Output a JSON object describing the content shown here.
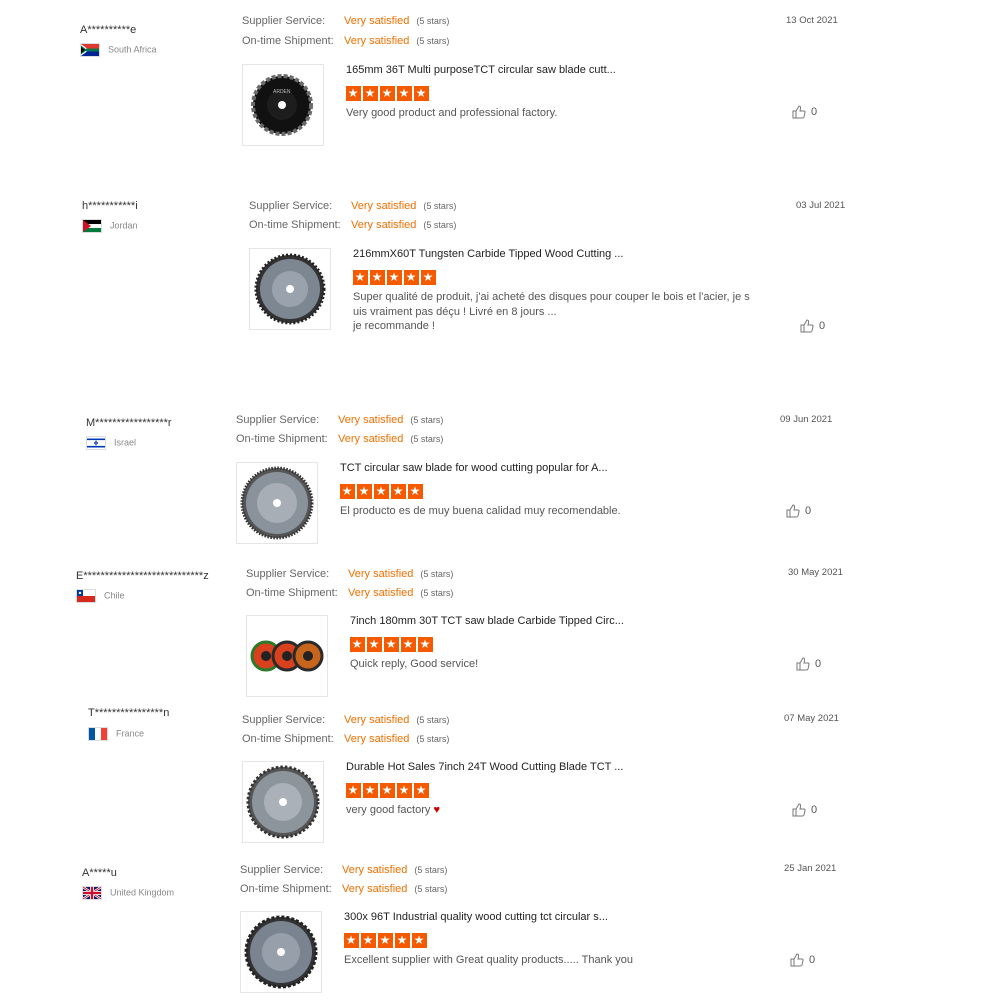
{
  "labels": {
    "supplier_service": "Supplier Service:",
    "ontime_shipment": "On-time Shipment:"
  },
  "reviews": [
    {
      "buyer": "A**********e",
      "country": "South Africa",
      "flag_icon": "south-africa-flag-icon",
      "supplier_service": "Very satisfied",
      "supplier_stars": "(5 stars)",
      "shipment": "Very satisfied",
      "shipment_stars": "(5 stars)",
      "date": "13 Oct 2021",
      "product_title": "165mm 36T Multi purposeTCT circular saw blade cutt...",
      "rating": 5,
      "comment": "Very good product and professional factory.",
      "likes": "0",
      "image_icon": "diamond-saw-blade-image"
    },
    {
      "buyer": "h***********i",
      "country": "Jordan",
      "flag_icon": "jordan-flag-icon",
      "supplier_service": "Very satisfied",
      "supplier_stars": "(5 stars)",
      "shipment": "Very satisfied",
      "shipment_stars": "(5 stars)",
      "date": "03 Jul 2021",
      "product_title": "216mmX60T Tungsten Carbide Tipped Wood Cutting ...",
      "rating": 5,
      "comment_lines": [
        "Super qualité de produit, j'ai acheté des disques pour couper le bois et l'acier, je s",
        "uis vraiment pas déçu ! Livré en 8 jours ...",
        "je recommande !"
      ],
      "likes": "0",
      "image_icon": "saw-blade-image"
    },
    {
      "buyer": "M*****************r",
      "country": "Israel",
      "flag_icon": "israel-flag-icon",
      "supplier_service": "Very satisfied",
      "supplier_stars": "(5 stars)",
      "shipment": "Very satisfied",
      "shipment_stars": "(5 stars)",
      "date": "09 Jun 2021",
      "product_title": "TCT circular saw blade for wood cutting popular for A...",
      "rating": 5,
      "comment": "El producto es de muy buena calidad muy recomendable.",
      "likes": "0",
      "image_icon": "saw-blade-image"
    },
    {
      "buyer": "E****************************z",
      "country": "Chile",
      "flag_icon": "chile-flag-icon",
      "supplier_service": "Very satisfied",
      "supplier_stars": "(5 stars)",
      "shipment": "Very satisfied",
      "shipment_stars": "(5 stars)",
      "date": "30 May 2021",
      "product_title": "7inch 180mm 30T TCT saw blade Carbide Tipped Circ...",
      "rating": 5,
      "comment": "Quick reply, Good service!",
      "likes": "0",
      "image_icon": "three-saw-blades-image"
    },
    {
      "buyer": "T****************n",
      "country": "France",
      "flag_icon": "france-flag-icon",
      "supplier_service": "Very satisfied",
      "supplier_stars": "(5 stars)",
      "shipment": "Very satisfied",
      "shipment_stars": "(5 stars)",
      "date": "07 May 2021",
      "product_title": "Durable Hot Sales 7inch 24T Wood Cutting Blade TCT ...",
      "rating": 5,
      "comment": "very good factory",
      "comment_suffix": "♥",
      "likes": "0",
      "image_icon": "saw-blade-image"
    },
    {
      "buyer": "A*****u",
      "country": "United Kingdom",
      "flag_icon": "uk-flag-icon",
      "supplier_service": "Very satisfied",
      "supplier_stars": "(5 stars)",
      "shipment": "Very satisfied",
      "shipment_stars": "(5 stars)",
      "date": "25 Jan 2021",
      "product_title": "300x 96T Industrial quality wood cutting tct circular s...",
      "rating": 5,
      "comment": "Excellent supplier with Great quality products..... Thank you",
      "likes": "0",
      "image_icon": "saw-blade-image"
    }
  ]
}
